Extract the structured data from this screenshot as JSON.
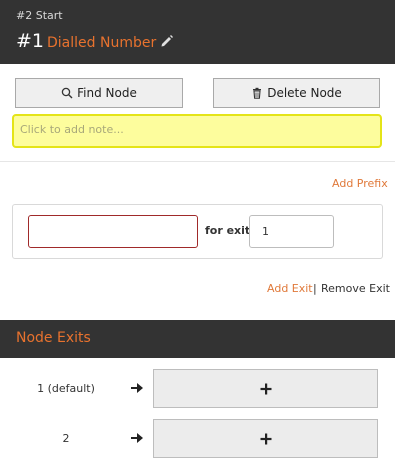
{
  "header": {
    "breadcrumb": "#2 Start",
    "node_number": "#1",
    "node_name": "Dialled Number",
    "edit_icon": "pencil-icon"
  },
  "toolbar": {
    "find_node_label": "Find Node",
    "find_node_icon": "search-icon",
    "delete_node_label": "Delete Node",
    "delete_node_icon": "trash-icon"
  },
  "note": {
    "placeholder": "Click to add note..."
  },
  "prefix": {
    "add_prefix_label": "Add Prefix",
    "prefix_value": "",
    "for_exit_label": "for exit",
    "exit_value": "1"
  },
  "exit_links": {
    "add_exit_label": "Add Exit",
    "separator": "|",
    "remove_exit_label": "Remove Exit"
  },
  "node_exits": {
    "title": "Node Exits",
    "exits": [
      {
        "label": "1 (default)"
      },
      {
        "label": "2"
      }
    ]
  },
  "colors": {
    "header_bg": "#333333",
    "accent": "#e8722e",
    "note_bg": "#fdfd9d",
    "invalid_border": "#a02a2a"
  }
}
